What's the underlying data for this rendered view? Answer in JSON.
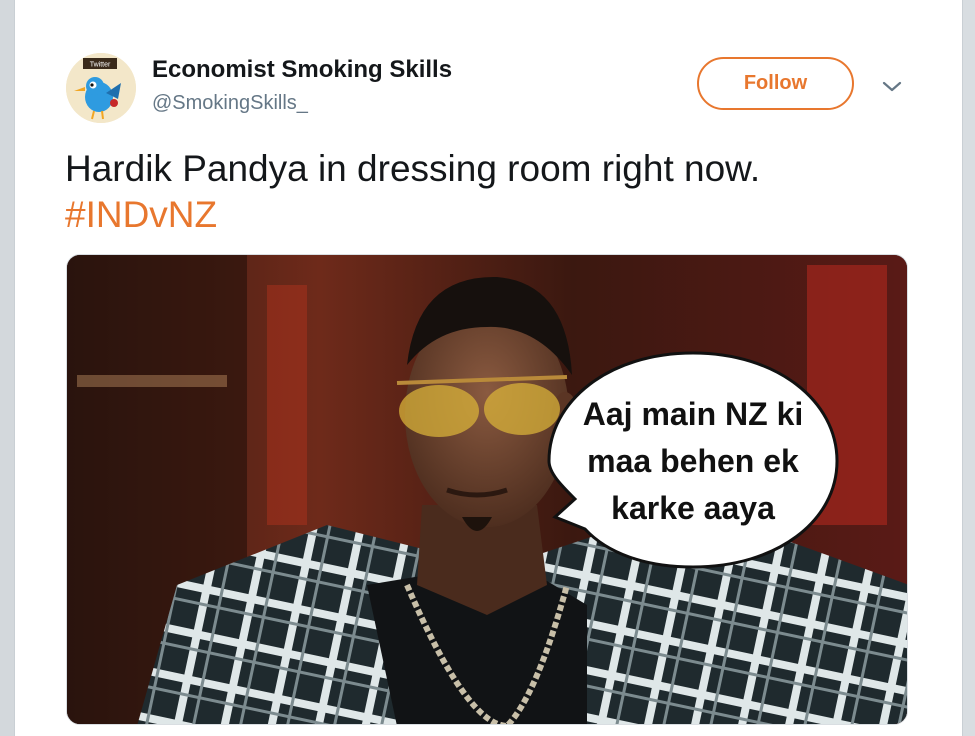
{
  "tweet": {
    "display_name": "Economist Smoking Skills",
    "screen_name": "@SmokingSkills_",
    "avatar_label": "Twitter",
    "follow_label": "Follow",
    "menu_icon": "chevron-down-icon",
    "text": "Hardik Pandya in dressing room right now.",
    "hashtag": "#INDvNZ",
    "accent_color": "#e8772e"
  },
  "media": {
    "caption_line1": "Aaj main NZ ki",
    "caption_line2": "maa behen ek",
    "caption_line3": "karke aaya"
  }
}
